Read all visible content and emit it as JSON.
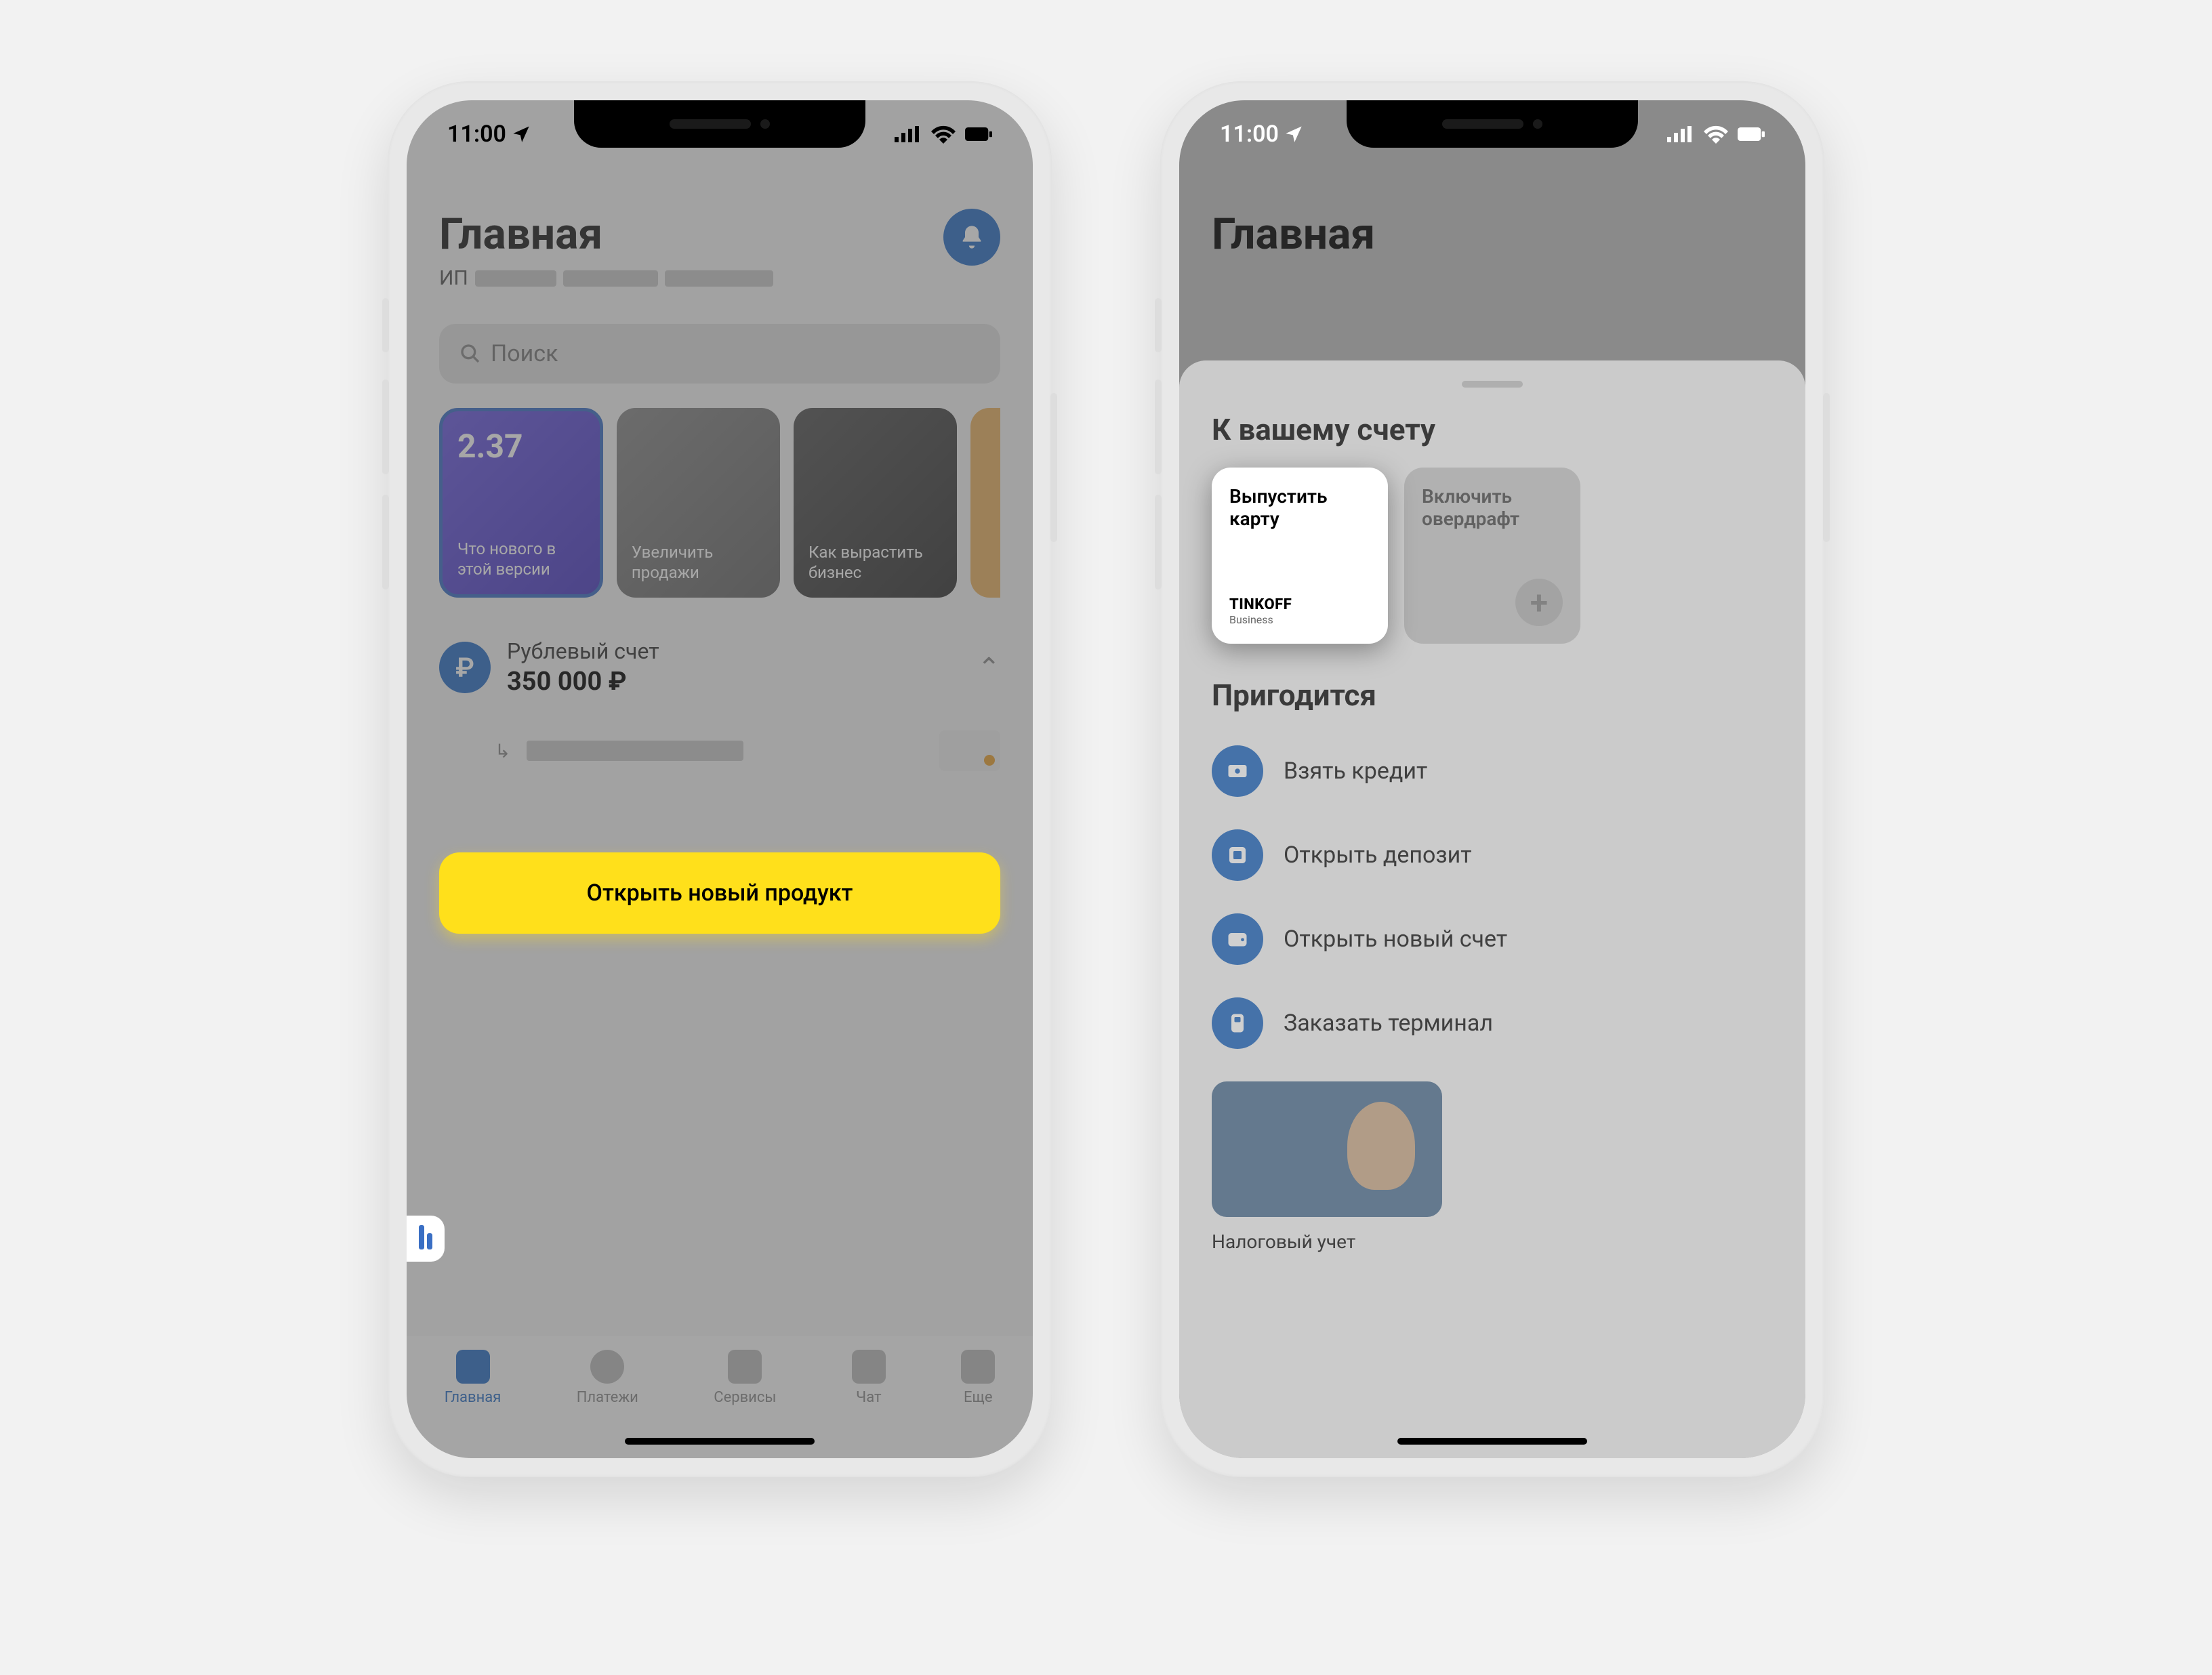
{
  "status": {
    "time": "11:00"
  },
  "phone1": {
    "header": {
      "title": "Главная",
      "prefix": "ИП"
    },
    "search": {
      "placeholder": "Поиск"
    },
    "stories": [
      {
        "badge": "2.37",
        "caption": "Что нового в этой версии"
      },
      {
        "caption": "Увеличить продажи"
      },
      {
        "caption": "Как вырастить бизнес"
      }
    ],
    "account": {
      "name": "Рублевый счет",
      "balance": "350 000 ₽"
    },
    "cta": "Открыть новый продукт",
    "tabs": [
      "Главная",
      "Платежи",
      "Сервисы",
      "Чат",
      "Еще"
    ]
  },
  "phone2": {
    "header": {
      "title": "Главная"
    },
    "sheet": {
      "section1_title": "К вашему счету",
      "options": [
        {
          "title": "Выпустить карту",
          "logo": "TINKOFF",
          "logo_sub": "Business"
        },
        {
          "title": "Включить овердрафт"
        }
      ],
      "section2_title": "Пригодится",
      "items": [
        "Взять кредит",
        "Открыть депозит",
        "Открыть новый счет",
        "Заказать терминал"
      ],
      "bottom_label": "Налоговый учет"
    }
  }
}
